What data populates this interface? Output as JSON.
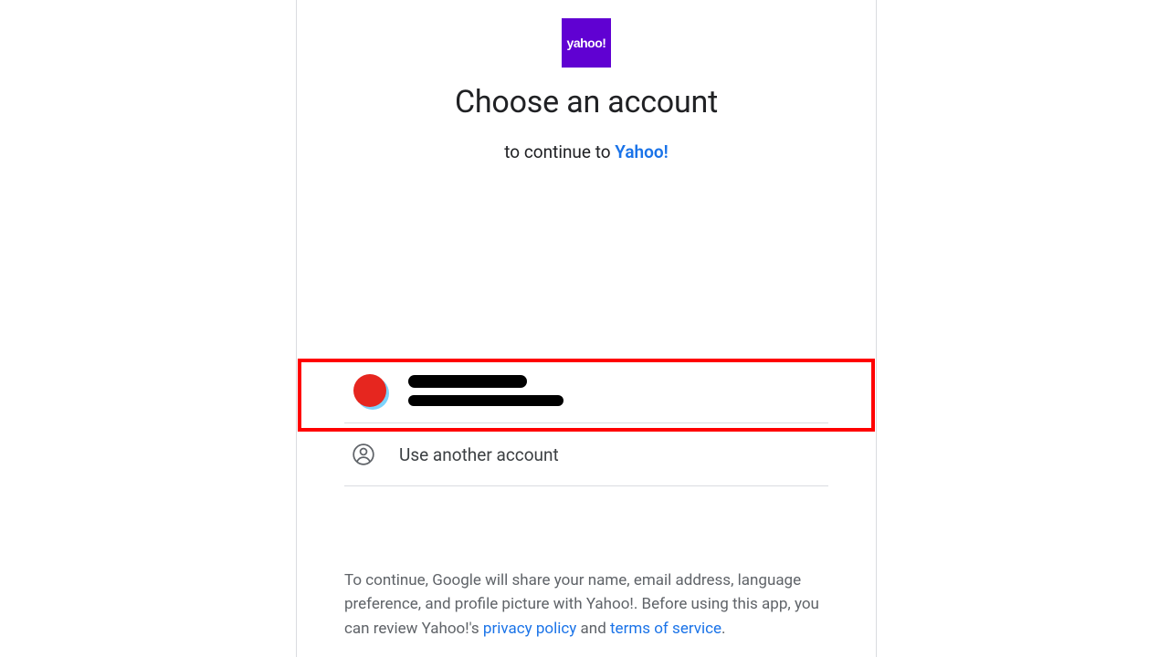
{
  "brand": {
    "logo_text": "yahoo",
    "logo_bg": "#6001d2"
  },
  "header": {
    "title": "Choose an account",
    "subtitle_prefix": "to continue to ",
    "subtitle_link": "Yahoo!"
  },
  "accounts": [
    {
      "display_name": "",
      "email": "",
      "avatar_color": "#e6261f",
      "redacted": true
    }
  ],
  "use_another_label": "Use another account",
  "disclosure": {
    "line1": "To continue, Google will share your name, email address, language preference, and profile picture with Yahoo!. Before using this app, you can review Yahoo!'s ",
    "privacy_link": "privacy policy",
    "between": " and ",
    "terms_link": "terms of service",
    "suffix": "."
  }
}
